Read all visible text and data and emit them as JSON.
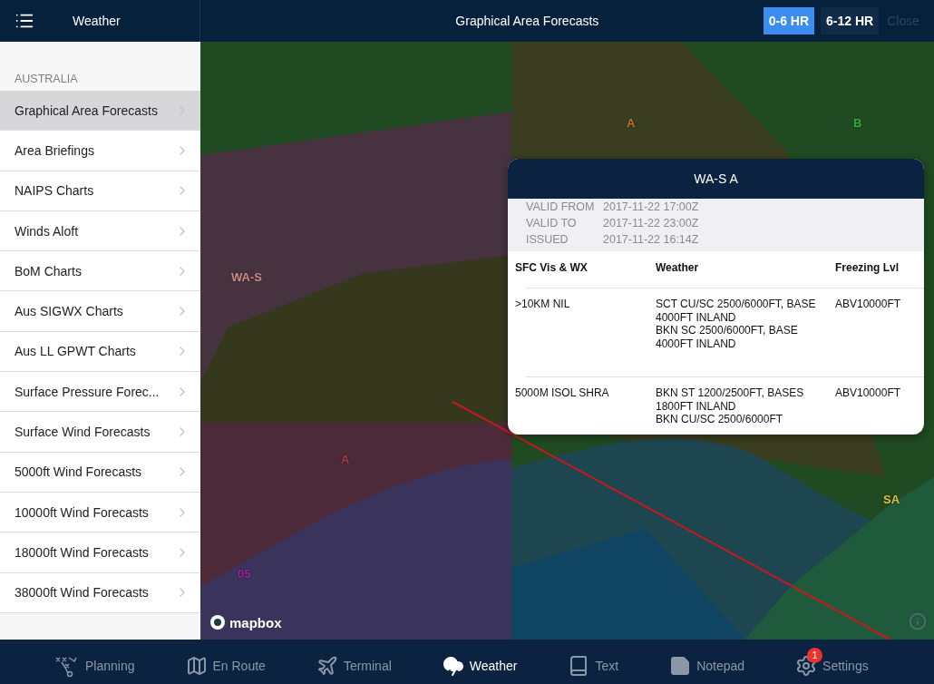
{
  "top_bar": {
    "menu_title": "Weather",
    "title": "Graphical Area Forecasts",
    "range_buttons": [
      {
        "label": "0-6 HR",
        "selected": true
      },
      {
        "label": "6-12 HR",
        "selected": false
      }
    ],
    "close": {
      "label": "Close",
      "disabled": true
    }
  },
  "sidebar": {
    "section": "AUSTRALIA",
    "items": [
      {
        "label": "Graphical Area Forecasts",
        "selected": true
      },
      {
        "label": "Area Briefings",
        "selected": false
      },
      {
        "label": "NAIPS Charts",
        "selected": false
      },
      {
        "label": "Winds Aloft",
        "selected": false
      },
      {
        "label": "BoM Charts",
        "selected": false
      },
      {
        "label": "Aus SIGWX Charts",
        "selected": false
      },
      {
        "label": "Aus LL GPWT Charts",
        "selected": false
      },
      {
        "label": "Surface Pressure Forec...",
        "selected": false
      },
      {
        "label": "Surface Wind Forecasts",
        "selected": false
      },
      {
        "label": "5000ft Wind Forecasts",
        "selected": false
      },
      {
        "label": "10000ft Wind Forecasts",
        "selected": false
      },
      {
        "label": "18000ft Wind Forecasts",
        "selected": false
      },
      {
        "label": "38000ft Wind Forecasts",
        "selected": false
      }
    ]
  },
  "map": {
    "labels": [
      {
        "text": "A",
        "color": "#c0742a"
      },
      {
        "text": "B",
        "color": "#2fae3a"
      },
      {
        "text": "WA-S",
        "color": "#c98a8a"
      },
      {
        "text": "A",
        "color": "#a83a4a"
      },
      {
        "text": "05",
        "color": "#a0209a"
      },
      {
        "text": "SA",
        "color": "#e0c040"
      }
    ],
    "attribution": "mapbox"
  },
  "popover": {
    "title": "WA-S A",
    "validity": [
      {
        "label": "VALID FROM",
        "value": "2017-11-22 17:00Z"
      },
      {
        "label": "VALID TO",
        "value": "2017-11-22 23:00Z"
      },
      {
        "label": "ISSUED",
        "value": "2017-11-22 16:14Z"
      }
    ],
    "columns": [
      "SFC Vis & WX",
      "Weather",
      "Freezing Lvl"
    ],
    "rows": [
      {
        "vis": ">10KM NIL",
        "weather": [
          "SCT CU/SC 2500/6000FT, BASE 4000FT INLAND",
          "BKN SC 2500/6000FT, BASE 4000FT INLAND"
        ],
        "freezing": "ABV10000FT"
      },
      {
        "vis": "5000M ISOL SHRA",
        "weather": [
          "BKN ST 1200/2500FT, BASES 1800FT INLAND",
          "BKN CU/SC 2500/6000FT"
        ],
        "freezing": "ABV10000FT"
      }
    ]
  },
  "tab_bar": [
    {
      "label": "Planning",
      "kind": "planning",
      "selected": false
    },
    {
      "label": "En Route",
      "kind": "enroute",
      "selected": false
    },
    {
      "label": "Terminal",
      "kind": "terminal",
      "selected": false
    },
    {
      "label": "Weather",
      "kind": "weather",
      "selected": true
    },
    {
      "label": "Text",
      "kind": "text",
      "selected": false
    },
    {
      "label": "Notepad",
      "kind": "notepad",
      "selected": false
    },
    {
      "label": "Settings",
      "kind": "settings",
      "selected": false,
      "badge": "1"
    }
  ]
}
